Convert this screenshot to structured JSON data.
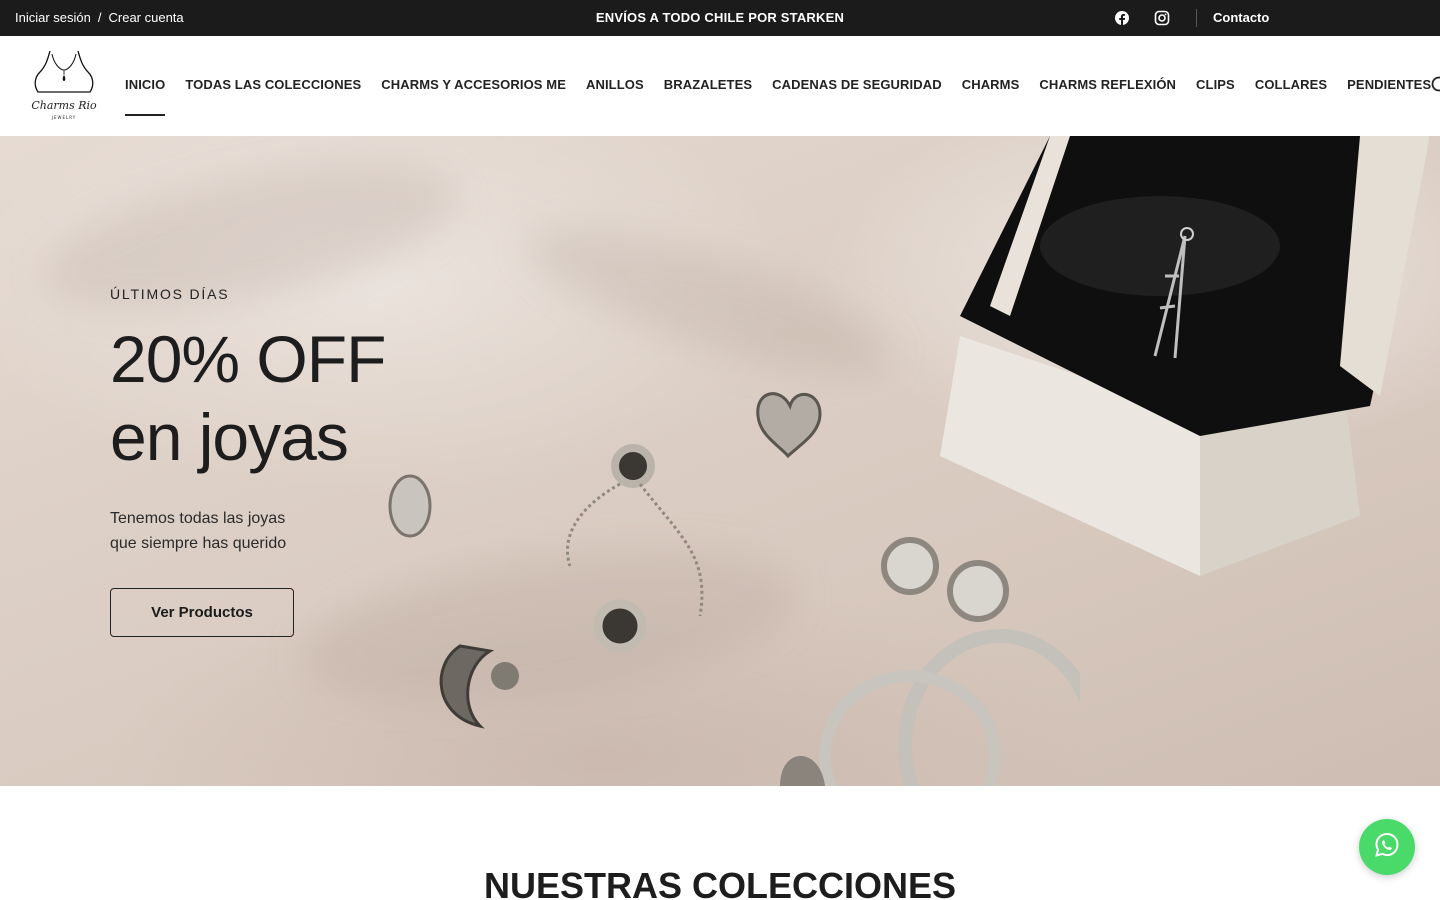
{
  "topbar": {
    "login_label": "Iniciar sesión",
    "separator": "/",
    "register_label": "Crear cuenta",
    "promo_text": "ENVÍOS A TODO CHILE POR STARKEN",
    "social_icons": [
      "facebook-icon",
      "instagram-icon"
    ],
    "contact_label": "Contacto"
  },
  "header": {
    "logo_icon": "charms-rio-jewelry-logo",
    "nav": [
      {
        "label": "INICIO",
        "active": true
      },
      {
        "label": "TODAS LAS COLECCIONES"
      },
      {
        "label": "CHARMS Y ACCESORIOS ME"
      },
      {
        "label": "ANILLOS"
      },
      {
        "label": "BRAZALETES"
      },
      {
        "label": "CADENAS DE SEGURIDAD"
      },
      {
        "label": "CHARMS"
      },
      {
        "label": "CHARMS REFLEXIÓN"
      },
      {
        "label": "CLIPS"
      },
      {
        "label": "COLLARES"
      },
      {
        "label": "PENDIENTES"
      }
    ],
    "search_icon": "search-icon"
  },
  "hero": {
    "kicker": "ÚLTIMOS DÍAS",
    "title_line1": "20% OFF",
    "title_line2": "en joyas",
    "subtitle_line1": "Tenemos todas las joyas",
    "subtitle_line2": "que siempre has querido",
    "button_label": "Ver Productos"
  },
  "collections": {
    "title": "NUESTRAS COLECCIONES"
  },
  "floating": {
    "whatsapp_icon": "whatsapp-icon"
  },
  "colors": {
    "topbar_bg": "#1b1b1b",
    "whatsapp_green": "#4ada69",
    "text_dark": "#1d1d1d"
  }
}
